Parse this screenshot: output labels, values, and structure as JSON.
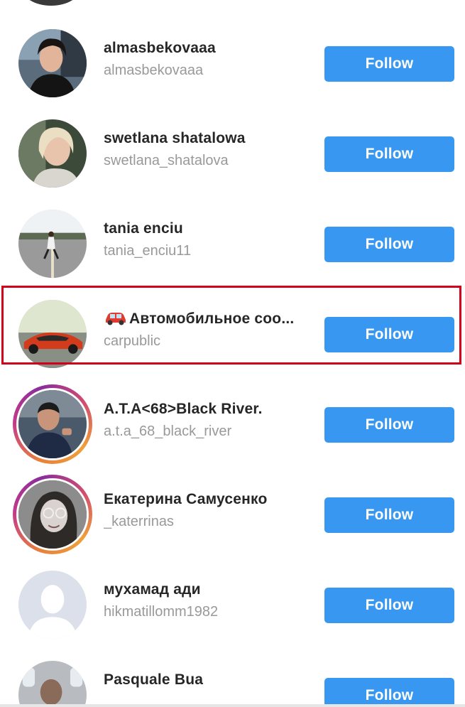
{
  "follow_label": "Follow",
  "accent_color": "#3897f0",
  "highlight_color": "#d0021b",
  "users": [
    {
      "name": "almasbekovaaa",
      "username": "almasbekovaaa",
      "story_ring": false,
      "highlighted": false
    },
    {
      "name": "swetlana shatalowa",
      "username": "swetlana_shatalova",
      "story_ring": false,
      "highlighted": false
    },
    {
      "name": "tania enciu",
      "username": "tania_enciu11",
      "story_ring": false,
      "highlighted": false
    },
    {
      "name": "Автомобильное соо...",
      "name_icon": "car-icon",
      "username": "carpublic",
      "story_ring": false,
      "highlighted": true
    },
    {
      "name": "A.T.A<68>Black River.",
      "username": "a.t.a_68_black_river",
      "story_ring": true,
      "highlighted": false
    },
    {
      "name": "Екатерина Самусенко",
      "username": "_katerrinas",
      "story_ring": true,
      "highlighted": false
    },
    {
      "name": "мухамад ади",
      "username": "hikmatillomm1982",
      "story_ring": false,
      "highlighted": false,
      "default_avatar": true
    },
    {
      "name": "Pasquale Bua",
      "username": "",
      "story_ring": false,
      "highlighted": false
    }
  ]
}
